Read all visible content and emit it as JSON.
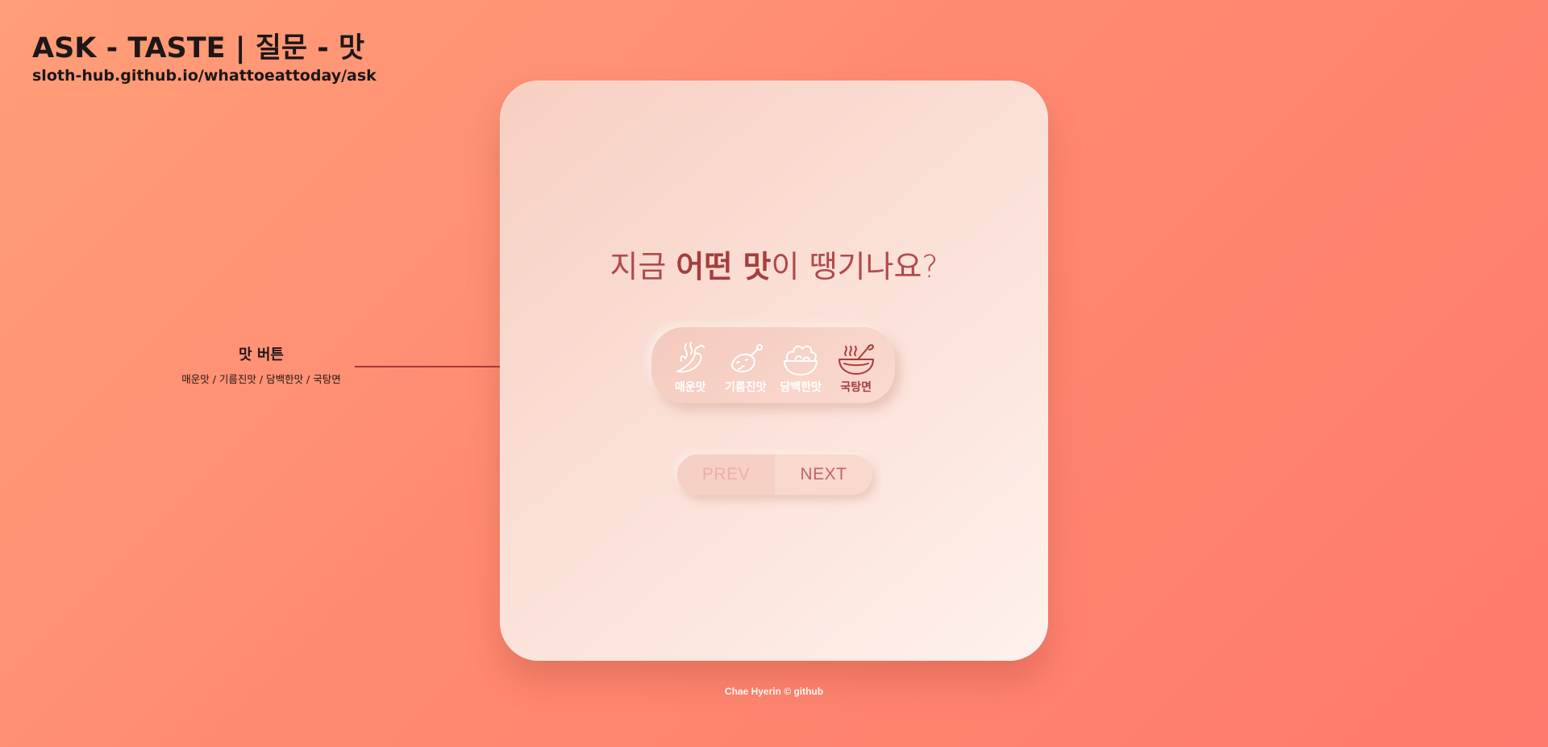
{
  "header": {
    "title": "ASK - TASTE | 질문 - 맛",
    "url": "sloth-hub.github.io/whattoeattoday/ask"
  },
  "card": {
    "question_pre": "지금 ",
    "question_bold": "어떤 맛",
    "question_post": "이 땡기나요?",
    "tastes": [
      {
        "label": "매운맛",
        "icon": "chili-pepper-icon"
      },
      {
        "label": "기름진맛",
        "icon": "fried-chicken-icon"
      },
      {
        "label": "담백한맛",
        "icon": "salad-bowl-icon"
      },
      {
        "label": "국탕면",
        "icon": "soup-bowl-icon"
      }
    ],
    "selected_taste": "국탕면",
    "prev_label": "PREV",
    "next_label": "NEXT"
  },
  "annotation": {
    "title": "맛 버튼",
    "subtitle": "매운맛 / 기름진맛 / 담백한맛 / 국탕면"
  },
  "footer": {
    "text": "Chae Hyerin © github"
  },
  "colors": {
    "background_start": "#ff9e78",
    "background_end": "#ff7a6c",
    "accent": "#a63d3d",
    "icon_inactive": "#ffffff",
    "icon_active": "#a63d3d"
  }
}
